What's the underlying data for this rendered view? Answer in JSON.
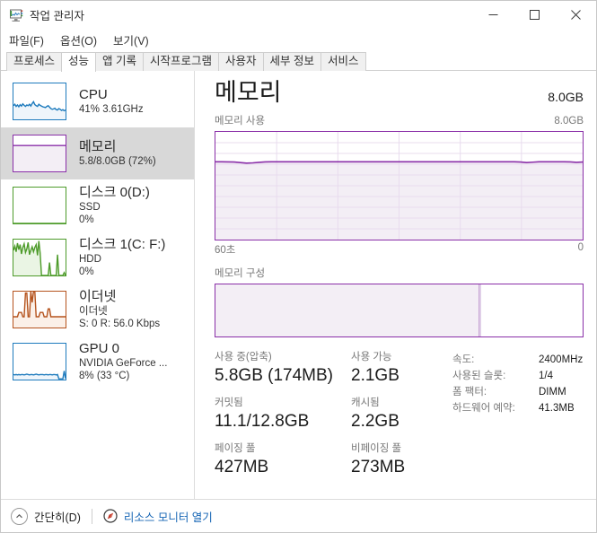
{
  "window": {
    "title": "작업 관리자",
    "icon": "task-manager-icon",
    "minimize": "─",
    "maximize": "□",
    "close": "✕"
  },
  "menu": {
    "items": [
      {
        "label": "파일(F)"
      },
      {
        "label": "옵션(O)"
      },
      {
        "label": "보기(V)"
      }
    ]
  },
  "tabs": {
    "active_index": 1,
    "items": [
      {
        "label": "프로세스"
      },
      {
        "label": "성능"
      },
      {
        "label": "앱 기록"
      },
      {
        "label": "시작프로그램"
      },
      {
        "label": "사용자"
      },
      {
        "label": "세부 정보"
      },
      {
        "label": "서비스"
      }
    ]
  },
  "sidebar": {
    "items": [
      {
        "name": "CPU",
        "line1": "41% 3.61GHz",
        "line2": "",
        "color": "#1e7bbd",
        "fill": "#eef5fb",
        "selected": false
      },
      {
        "name": "메모리",
        "line1": "5.8/8.0GB (72%)",
        "line2": "",
        "color": "#8a2fa8",
        "fill": "#f3eef5",
        "selected": true
      },
      {
        "name": "디스크 0(D:)",
        "line1": "SSD",
        "line2": "0%",
        "color": "#4d9b2a",
        "fill": "#f0f7ec",
        "selected": false
      },
      {
        "name": "디스크 1(C: F:)",
        "line1": "HDD",
        "line2": "0%",
        "color": "#4d9b2a",
        "fill": "#eaf5e4",
        "selected": false
      },
      {
        "name": "이더넷",
        "line1": "이더넷",
        "line2": "S: 0 R: 56.0 Kbps",
        "color": "#b5531d",
        "fill": "#fbf0e8",
        "selected": false
      },
      {
        "name": "GPU 0",
        "line1": "NVIDIA GeForce ...",
        "line2": "8% (33 °C)",
        "color": "#1e7bbd",
        "fill": "#eef5fb",
        "selected": false
      }
    ]
  },
  "main": {
    "title": "메모리",
    "capacity": "8.0GB",
    "graph_label": "메모리 사용",
    "graph_max": "8.0GB",
    "axis_left": "60초",
    "axis_right": "0",
    "composition_label": "메모리 구성"
  },
  "stats": {
    "groups": [
      {
        "cells": [
          {
            "label": "사용 중(압축)",
            "value": "5.8GB (174MB)",
            "width": "wide"
          },
          {
            "label": "사용 가능",
            "value": "2.1GB",
            "width": "narrow"
          }
        ]
      },
      {
        "cells": [
          {
            "label": "커밋됨",
            "value": "11.1/12.8GB",
            "width": "wide"
          },
          {
            "label": "캐시됨",
            "value": "2.2GB",
            "width": "narrow"
          }
        ]
      },
      {
        "cells": [
          {
            "label": "페이징 풀",
            "value": "427MB",
            "width": "wide"
          },
          {
            "label": "비페이징 풀",
            "value": "273MB",
            "width": "narrow"
          }
        ]
      }
    ]
  },
  "specs": [
    {
      "key": "속도:",
      "value": "2400MHz"
    },
    {
      "key": "사용된 슬롯:",
      "value": "1/4"
    },
    {
      "key": "폼 팩터:",
      "value": "DIMM"
    },
    {
      "key": "하드웨어 예약:",
      "value": "41.3MB"
    }
  ],
  "footer": {
    "collapse_label": "간단히(D)",
    "resource_monitor_label": "리소스 모니터 열기"
  },
  "chart_data": {
    "type": "area",
    "title": "메모리 사용",
    "xlabel": "60초",
    "ylabel": "8.0GB",
    "xlim": [
      60,
      0
    ],
    "ylim": [
      0,
      8.0
    ],
    "grid": true,
    "series": [
      {
        "name": "메모리 사용",
        "unit": "GB",
        "color": "#8a2fa8",
        "fill": "#f3eef5",
        "values": [
          5.78,
          5.78,
          5.77,
          5.76,
          5.72,
          5.68,
          5.7,
          5.74,
          5.77,
          5.78,
          5.78,
          5.78,
          5.78,
          5.78,
          5.78,
          5.78,
          5.78,
          5.78,
          5.78,
          5.78,
          5.78,
          5.78,
          5.78,
          5.78,
          5.78,
          5.78,
          5.78,
          5.78,
          5.78,
          5.78,
          5.78,
          5.78,
          5.78,
          5.78,
          5.78,
          5.78,
          5.78,
          5.78,
          5.78,
          5.78,
          5.78,
          5.78,
          5.78,
          5.78,
          5.78,
          5.78,
          5.78,
          5.78,
          5.78,
          5.76,
          5.72,
          5.75,
          5.78,
          5.78,
          5.78,
          5.78,
          5.78,
          5.77,
          5.74,
          5.76
        ]
      }
    ],
    "composition": {
      "in_use_percent": 72,
      "available_percent": 28
    }
  },
  "thumb_series": {
    "cpu": [
      38,
      42,
      36,
      40,
      35,
      41,
      37,
      43,
      39,
      36,
      40,
      38,
      42,
      37,
      44,
      49,
      41,
      38,
      36,
      42,
      39,
      37,
      35,
      34,
      33,
      36,
      38,
      34,
      30,
      28,
      29,
      31,
      27,
      26,
      30,
      28,
      25,
      27,
      24,
      26
    ],
    "memory": [
      72,
      72,
      72,
      72,
      72,
      72,
      72,
      72,
      72,
      72,
      72,
      72,
      72,
      72,
      72,
      72,
      72,
      72,
      72,
      72,
      72,
      72,
      72,
      72,
      72,
      72,
      72,
      72,
      72,
      72,
      72,
      72,
      72,
      72,
      72,
      72,
      72,
      72,
      72,
      72
    ],
    "disk0": [
      0,
      0,
      0,
      0,
      0,
      0,
      0,
      0,
      0,
      0,
      0,
      0,
      0,
      0,
      0,
      0,
      0,
      0,
      0,
      0,
      0,
      0,
      0,
      0,
      0,
      0,
      0,
      0,
      0,
      0,
      0,
      0,
      0,
      0,
      0,
      0,
      0,
      0,
      0,
      0
    ],
    "disk1": [
      70,
      82,
      66,
      90,
      72,
      86,
      60,
      78,
      88,
      64,
      74,
      92,
      58,
      70,
      80,
      66,
      78,
      86,
      56,
      96,
      62,
      0,
      0,
      0,
      0,
      0,
      0,
      36,
      0,
      0,
      0,
      0,
      0,
      58,
      0,
      0,
      0,
      0,
      8,
      0
    ],
    "ethernet": [
      30,
      30,
      30,
      30,
      42,
      42,
      42,
      30,
      30,
      96,
      96,
      30,
      30,
      100,
      70,
      100,
      100,
      30,
      30,
      30,
      42,
      42,
      42,
      30,
      30,
      30,
      52,
      52,
      30,
      30,
      30,
      30,
      30,
      30,
      30,
      30,
      30,
      30,
      30,
      30
    ],
    "gpu": [
      14,
      13,
      14,
      13,
      14,
      13,
      14,
      14,
      13,
      14,
      15,
      14,
      13,
      14,
      14,
      13,
      14,
      15,
      14,
      13,
      14,
      14,
      14,
      13,
      14,
      14,
      13,
      14,
      14,
      13,
      14,
      14,
      13,
      14,
      2,
      2,
      2,
      2,
      24,
      3
    ]
  }
}
